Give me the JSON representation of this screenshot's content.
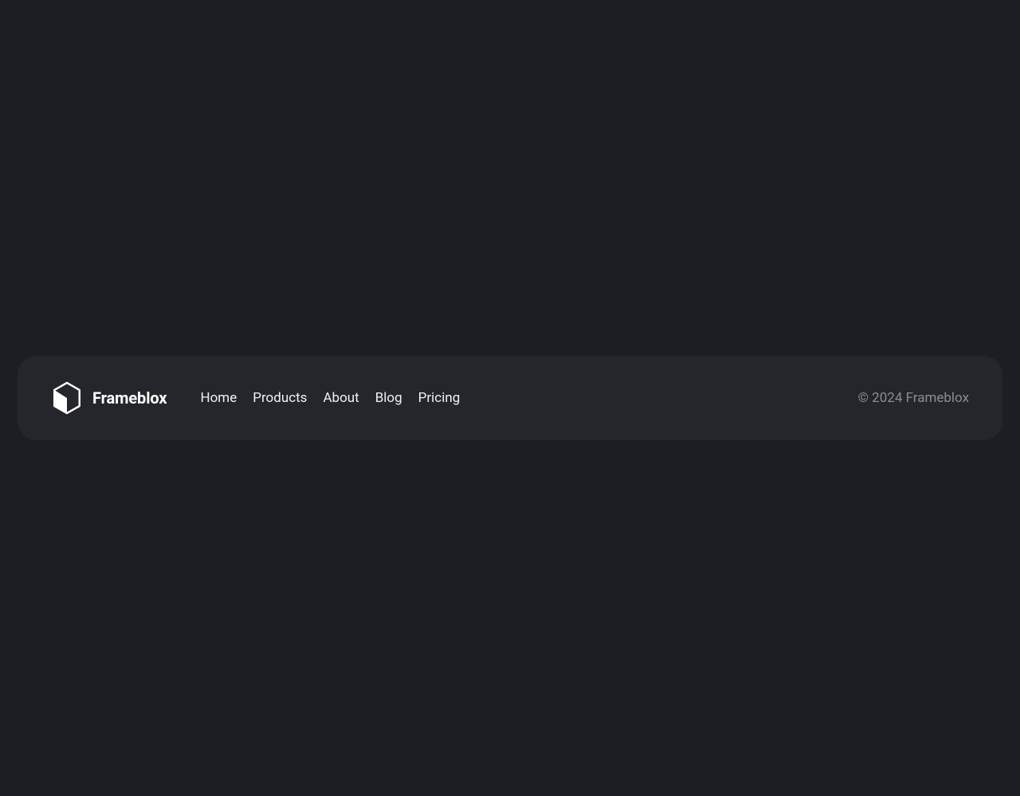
{
  "brand": {
    "name": "Frameblox"
  },
  "nav": {
    "items": [
      {
        "label": "Home"
      },
      {
        "label": "Products"
      },
      {
        "label": "About"
      },
      {
        "label": "Blog"
      },
      {
        "label": "Pricing"
      }
    ]
  },
  "footer": {
    "copyright": "© 2024 Frameblox"
  }
}
